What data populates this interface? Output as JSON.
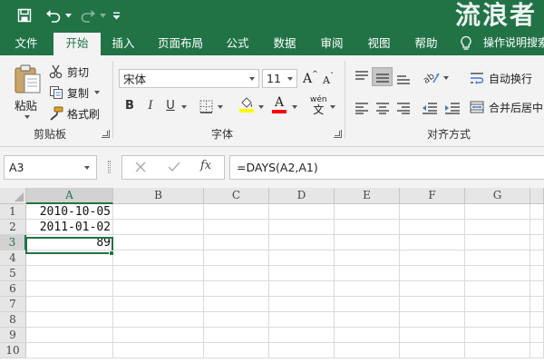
{
  "watermark": "流浪者",
  "tabs": [
    {
      "label": "文件",
      "active": false
    },
    {
      "label": "开始",
      "active": true
    },
    {
      "label": "插入",
      "active": false
    },
    {
      "label": "页面布局",
      "active": false
    },
    {
      "label": "公式",
      "active": false
    },
    {
      "label": "数据",
      "active": false
    },
    {
      "label": "审阅",
      "active": false
    },
    {
      "label": "视图",
      "active": false
    },
    {
      "label": "帮助",
      "active": false
    }
  ],
  "tell_me": "操作说明搜索",
  "clipboard": {
    "paste": "粘贴",
    "cut": "剪切",
    "copy": "复制",
    "format_painter": "格式刷",
    "group_label": "剪贴板"
  },
  "font": {
    "name": "宋体",
    "size": "11",
    "increase": "A",
    "decrease": "A",
    "bold": "B",
    "italic": "I",
    "underline": "U",
    "font_color_letter": "A",
    "phonetic": "wén",
    "phonetic_sub": "文",
    "group_label": "字体"
  },
  "alignment": {
    "wrap_text": "自动换行",
    "merge_center": "合并后居中",
    "group_label": "对齐方式"
  },
  "formula_bar": {
    "name_box": "A3",
    "fx": "fx",
    "formula": "=DAYS(A2,A1)"
  },
  "columns": [
    "A",
    "B",
    "C",
    "D",
    "E",
    "F",
    "G"
  ],
  "rows": [
    "1",
    "2",
    "3",
    "4",
    "5",
    "6",
    "7",
    "8",
    "9",
    "10"
  ],
  "cells": {
    "A1": "2010-10-05",
    "A2": "2011-01-02",
    "A3": "89"
  },
  "active_cell": "A3",
  "colors": {
    "accent": "#217346",
    "highlight_yellow": "#ffff00",
    "font_red": "#ff0000"
  }
}
